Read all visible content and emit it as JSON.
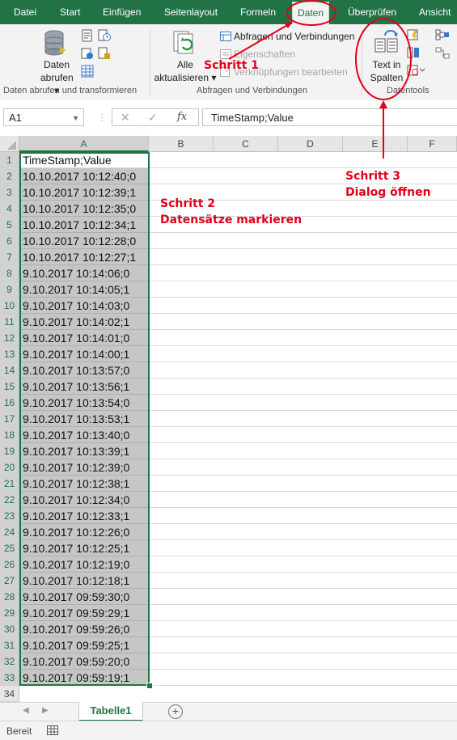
{
  "ribbon_tabs": [
    "Datei",
    "Start",
    "Einfügen",
    "Seitenlayout",
    "Formeln",
    "Daten",
    "Überprüfen",
    "Ansicht"
  ],
  "ribbon": {
    "daten_abrufen_label1": "Daten",
    "daten_abrufen_label2": "abrufen",
    "group1_label": "Daten abrufen und transformieren",
    "alle_aktualisieren_label1": "Alle",
    "alle_aktualisieren_label2": "aktualisieren",
    "abfragen_label": "Abfragen und Verbindungen",
    "eigenschaften_label": "Eigenschaften",
    "verknuepfungen_label": "Verknüpfungen bearbeiten",
    "group2_label": "Abfragen und Verbindungen",
    "text_in_spalten_label1": "Text in",
    "text_in_spalten_label2": "Spalten",
    "group3_label": "Datentools"
  },
  "formula_bar": {
    "name_box": "A1",
    "cancel_symbol": "✕",
    "enter_symbol": "✓",
    "fx_symbol": "fx",
    "formula": "TimeStamp;Value"
  },
  "columns": [
    "A",
    "B",
    "C",
    "D",
    "E",
    "F"
  ],
  "rows": [
    "1",
    "2",
    "3",
    "4",
    "5",
    "6",
    "7",
    "8",
    "9",
    "10",
    "11",
    "12",
    "13",
    "14",
    "15",
    "16",
    "17",
    "18",
    "19",
    "20",
    "21",
    "22",
    "23",
    "24",
    "25",
    "26",
    "27",
    "28",
    "29",
    "30",
    "31",
    "32",
    "33",
    "34"
  ],
  "cells_a": [
    "TimeStamp;Value",
    "10.10.2017 10:12:40;0",
    "10.10.2017 10:12:39;1",
    "10.10.2017 10:12:35;0",
    "10.10.2017 10:12:34;1",
    "10.10.2017 10:12:28;0",
    "10.10.2017 10:12:27;1",
    "9.10.2017 10:14:06;0",
    "9.10.2017 10:14:05;1",
    "9.10.2017 10:14:03;0",
    "9.10.2017 10:14:02;1",
    "9.10.2017 10:14:01;0",
    "9.10.2017 10:14:00;1",
    "9.10.2017 10:13:57;0",
    "9.10.2017 10:13:56;1",
    "9.10.2017 10:13:54;0",
    "9.10.2017 10:13:53;1",
    "9.10.2017 10:13:40;0",
    "9.10.2017 10:13:39;1",
    "9.10.2017 10:12:39;0",
    "9.10.2017 10:12:38;1",
    "9.10.2017 10:12:34;0",
    "9.10.2017 10:12:33;1",
    "9.10.2017 10:12:26;0",
    "9.10.2017 10:12:25;1",
    "9.10.2017 10:12:19;0",
    "9.10.2017 10:12:18;1",
    "9.10.2017 09:59:30;0",
    "9.10.2017 09:59:29;1",
    "9.10.2017 09:59:26;0",
    "9.10.2017 09:59:25;1",
    "9.10.2017 09:59:20;0",
    "9.10.2017 09:59:19;1"
  ],
  "sheet_tab": "Tabelle1",
  "add_sheet_symbol": "+",
  "status": "Bereit",
  "annotations": {
    "step1": "Schritt 1",
    "step2_line1": "Schritt 2",
    "step2_line2": "Datensätze markieren",
    "step3_line1": "Schritt 3",
    "step3_line2": "Dialog öffnen"
  },
  "colors": {
    "excel_green": "#217346",
    "annotation_red": "#e2001a",
    "selection_gray": "#c6c6c6"
  }
}
